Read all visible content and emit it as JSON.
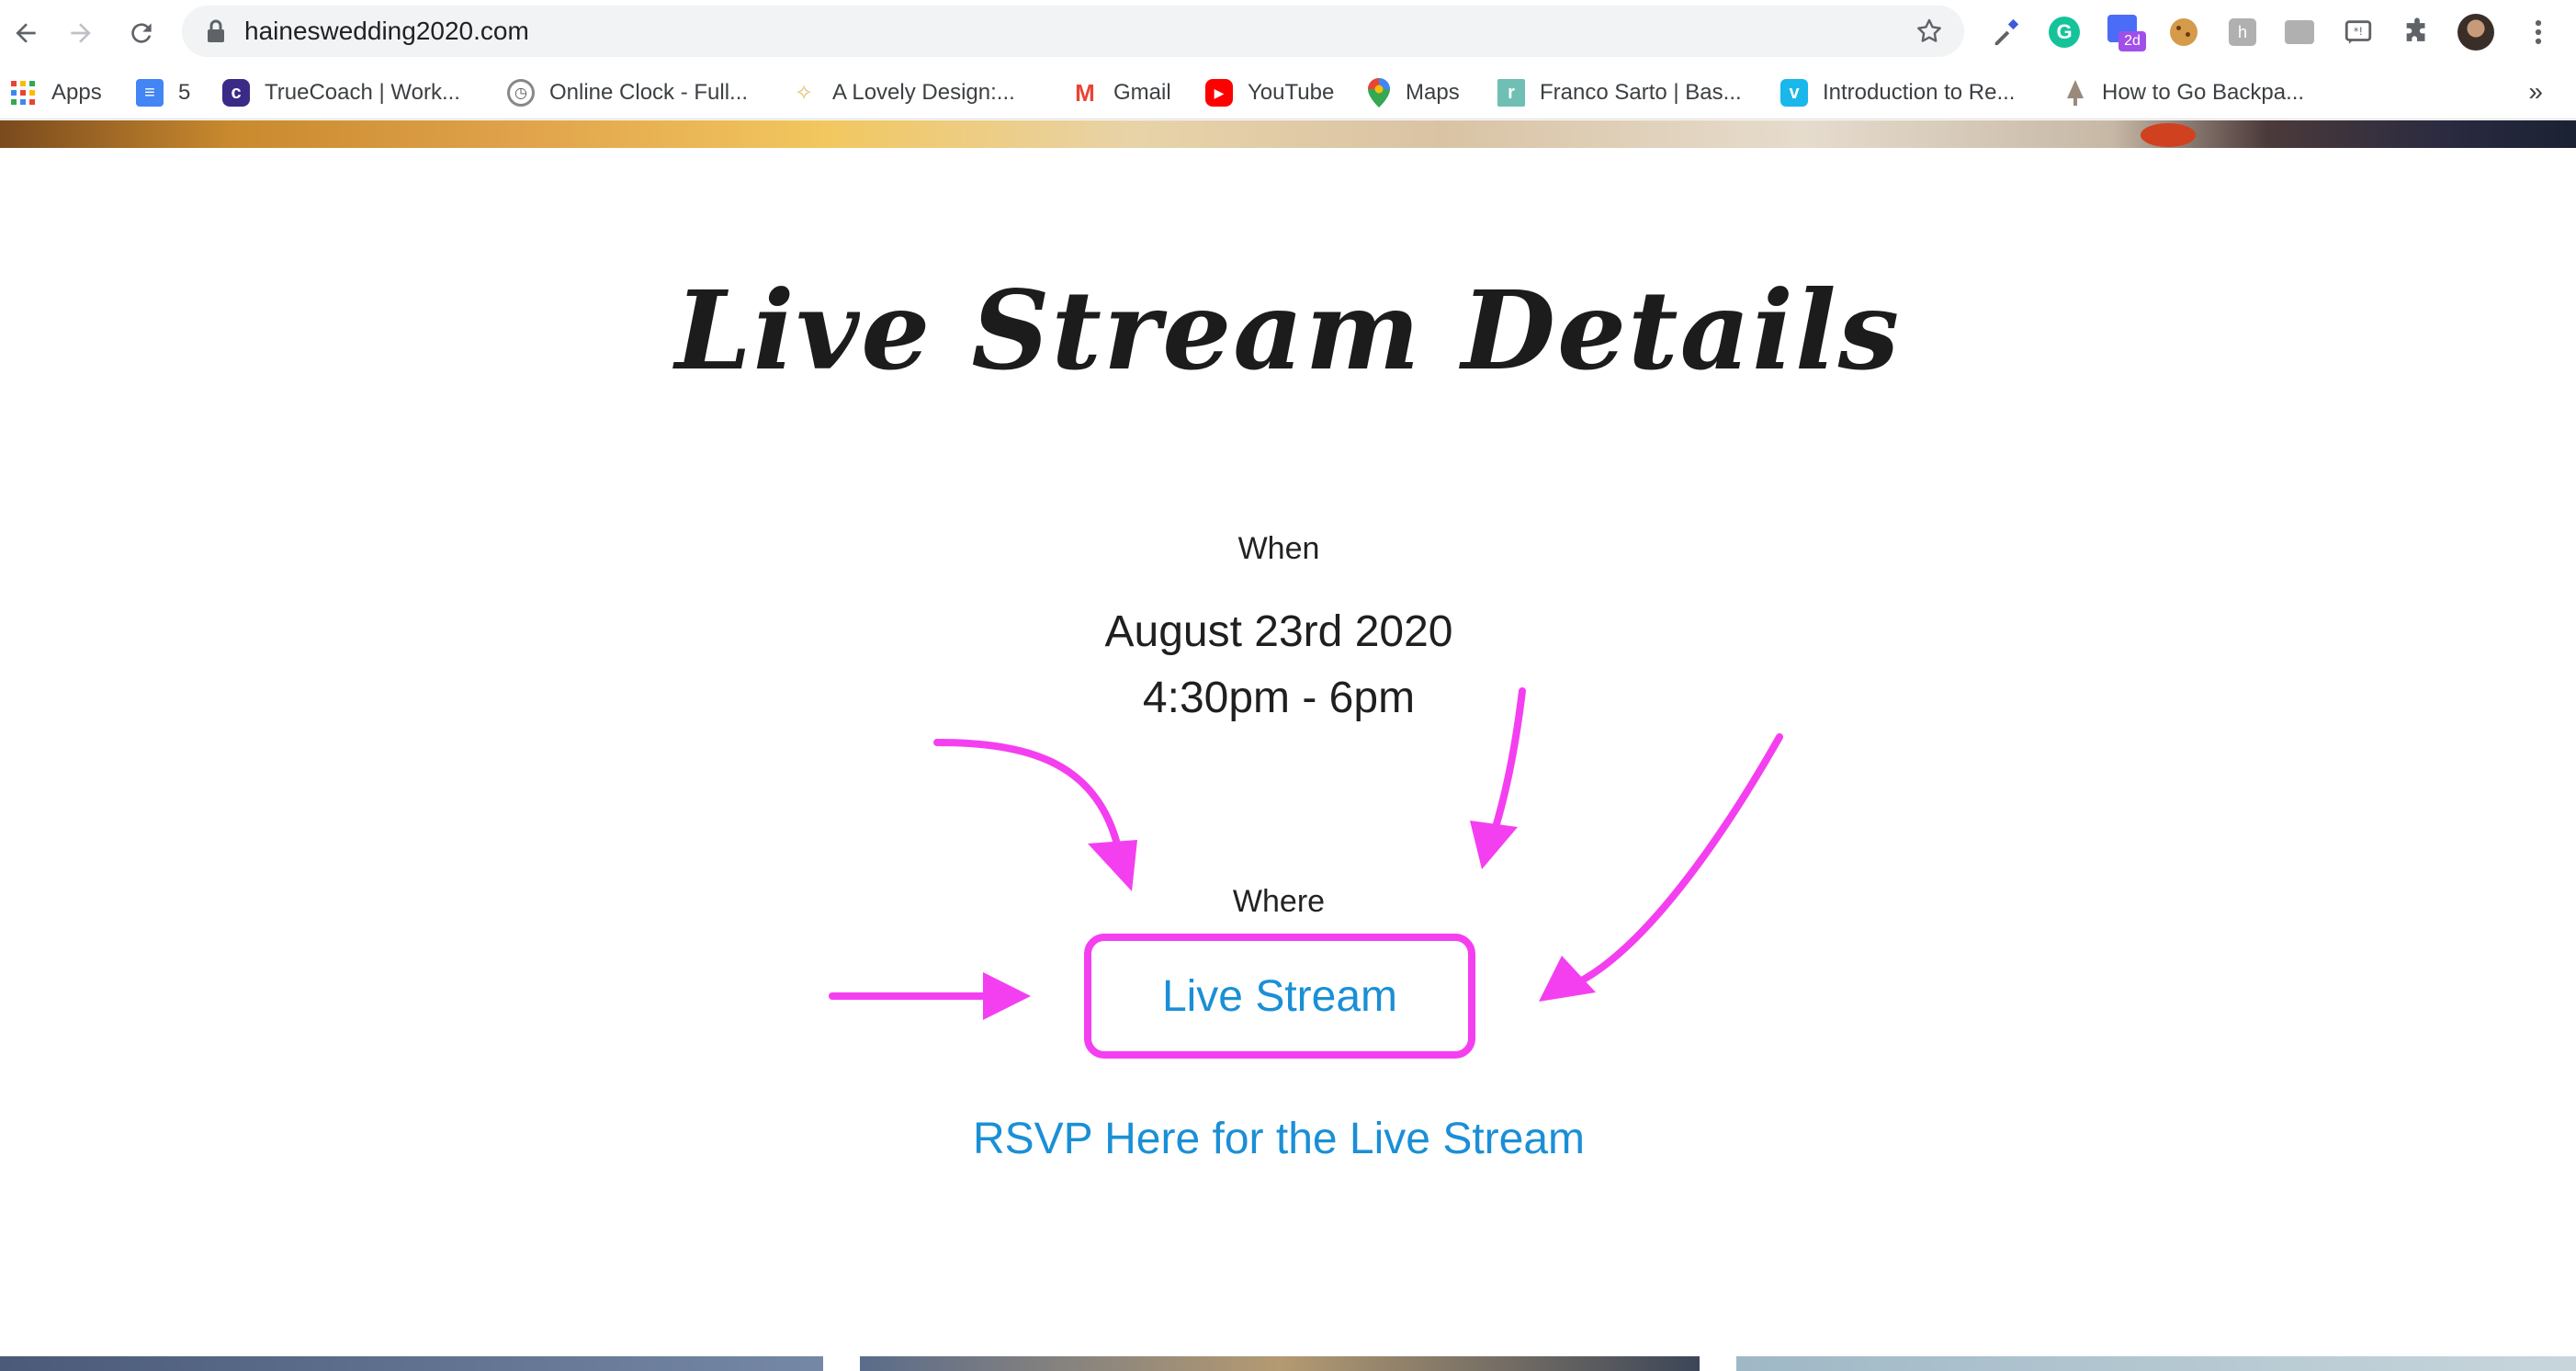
{
  "browser": {
    "url": "haineswedding2020.com",
    "extensions": [
      {
        "name": "eyedropper-extension-icon",
        "color": "#5f6368"
      },
      {
        "name": "grammarly-extension-icon",
        "color": "#15c39a",
        "glyph": "G"
      },
      {
        "name": "calendar-extension-icon",
        "color": "#4a6cf7",
        "badge": "2d"
      },
      {
        "name": "cookie-extension-icon",
        "color": "#d59a4a"
      },
      {
        "name": "hunter-extension-icon",
        "color": "#b0b0b0"
      },
      {
        "name": "screen-extension-icon",
        "color": "#b0b0b0"
      },
      {
        "name": "feedback-extension-icon",
        "color": "#5f6368"
      },
      {
        "name": "puzzle-extensions-icon",
        "color": "#5f6368"
      }
    ]
  },
  "bookmarks": [
    {
      "label": "Apps",
      "icon": "apps-grid-icon",
      "color": "#ea4335"
    },
    {
      "label": "5",
      "icon": "docs-icon",
      "color": "#4285f4"
    },
    {
      "label": "TrueCoach | Work...",
      "icon": "truecoach-icon",
      "color": "#3b2a86"
    },
    {
      "label": "Online Clock - Full...",
      "icon": "clock-icon",
      "color": "#888888"
    },
    {
      "label": "A Lovely Design:...",
      "icon": "sparkle-icon",
      "color": "#e5c07b"
    },
    {
      "label": "Gmail",
      "icon": "gmail-icon",
      "color": "#ea4335"
    },
    {
      "label": "YouTube",
      "icon": "youtube-icon",
      "color": "#ff0000"
    },
    {
      "label": "Maps",
      "icon": "maps-pin-icon",
      "color": "#34a853"
    },
    {
      "label": "Franco Sarto | Bas...",
      "icon": "franco-sarto-icon",
      "color": "#6fbfb4"
    },
    {
      "label": "Introduction to Re...",
      "icon": "vimeo-icon",
      "color": "#1ab7ea"
    },
    {
      "label": "How to Go Backpa...",
      "icon": "tree-icon",
      "color": "#9a8a7a"
    }
  ],
  "bookmarks_more": "»",
  "page": {
    "title": "Live Stream Details",
    "when_label": "When",
    "date": "August 23rd 2020",
    "time": "4:30pm - 6pm",
    "where_label": "Where",
    "live_stream_link": "Live Stream",
    "rsvp_link": "RSVP Here for the Live Stream",
    "annotation_color": "#f43ff0",
    "link_color": "#1a8fd6"
  }
}
